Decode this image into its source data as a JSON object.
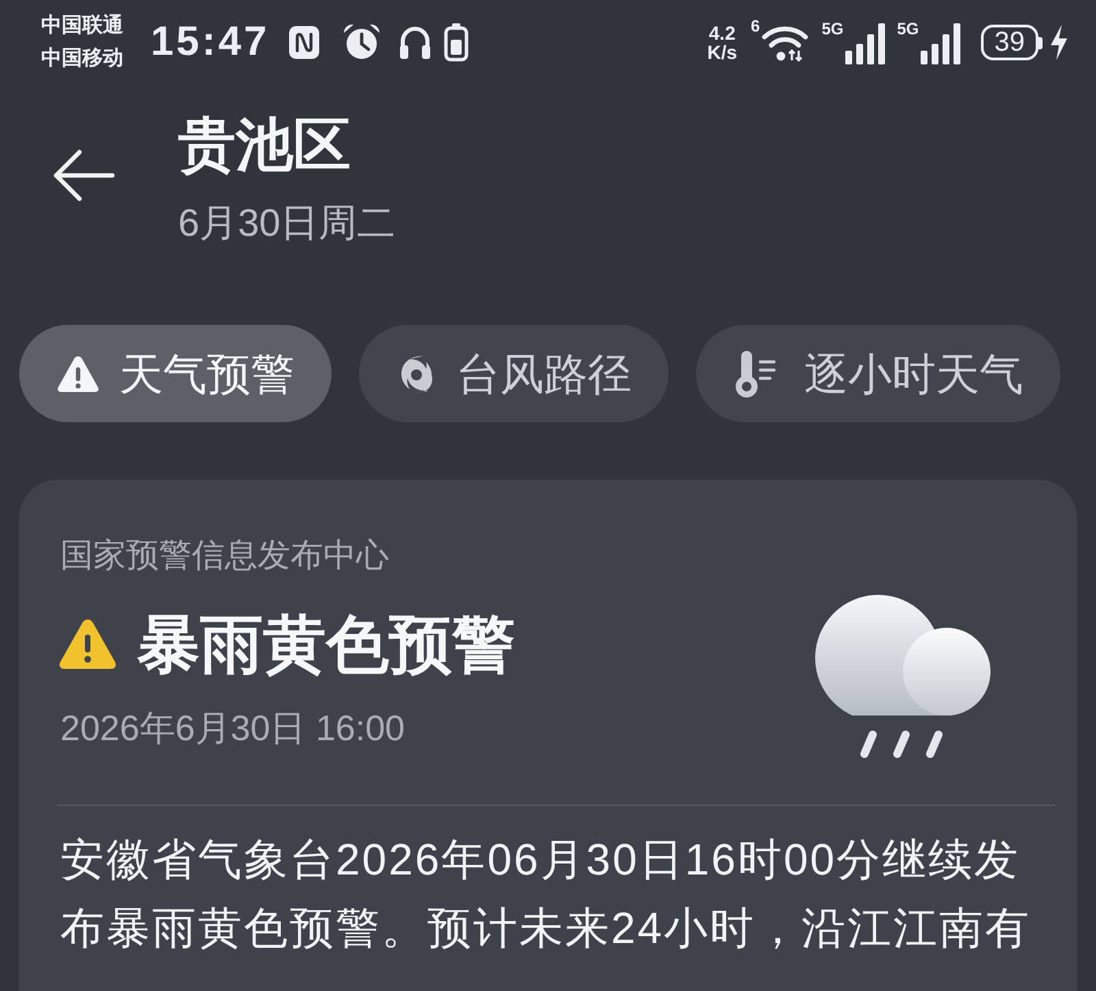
{
  "status_bar": {
    "carriers": [
      "中国联通",
      "中国移动"
    ],
    "time": "15:47",
    "net_speed": {
      "value": "4.2",
      "unit": "K/s"
    },
    "wifi_badge": "6",
    "sim_signals": [
      {
        "label": "5G"
      },
      {
        "label": "5G"
      }
    ],
    "battery": "39",
    "charging": true
  },
  "header": {
    "title": "贵池区",
    "subtitle": "6月30日周二"
  },
  "chips": [
    {
      "label": "天气预警",
      "selected": true
    },
    {
      "label": "台风路径",
      "selected": false
    },
    {
      "label": "逐小时天气",
      "selected": false
    }
  ],
  "alert": {
    "source": "国家预警信息发布中心",
    "title": "暴雨黄色预警",
    "time": "2026年6月30日 16:00",
    "description": "安徽省气象台2026年06月30日16时00分继续发布暴雨黄色预警。预计未来24小时，沿江江南有"
  }
}
